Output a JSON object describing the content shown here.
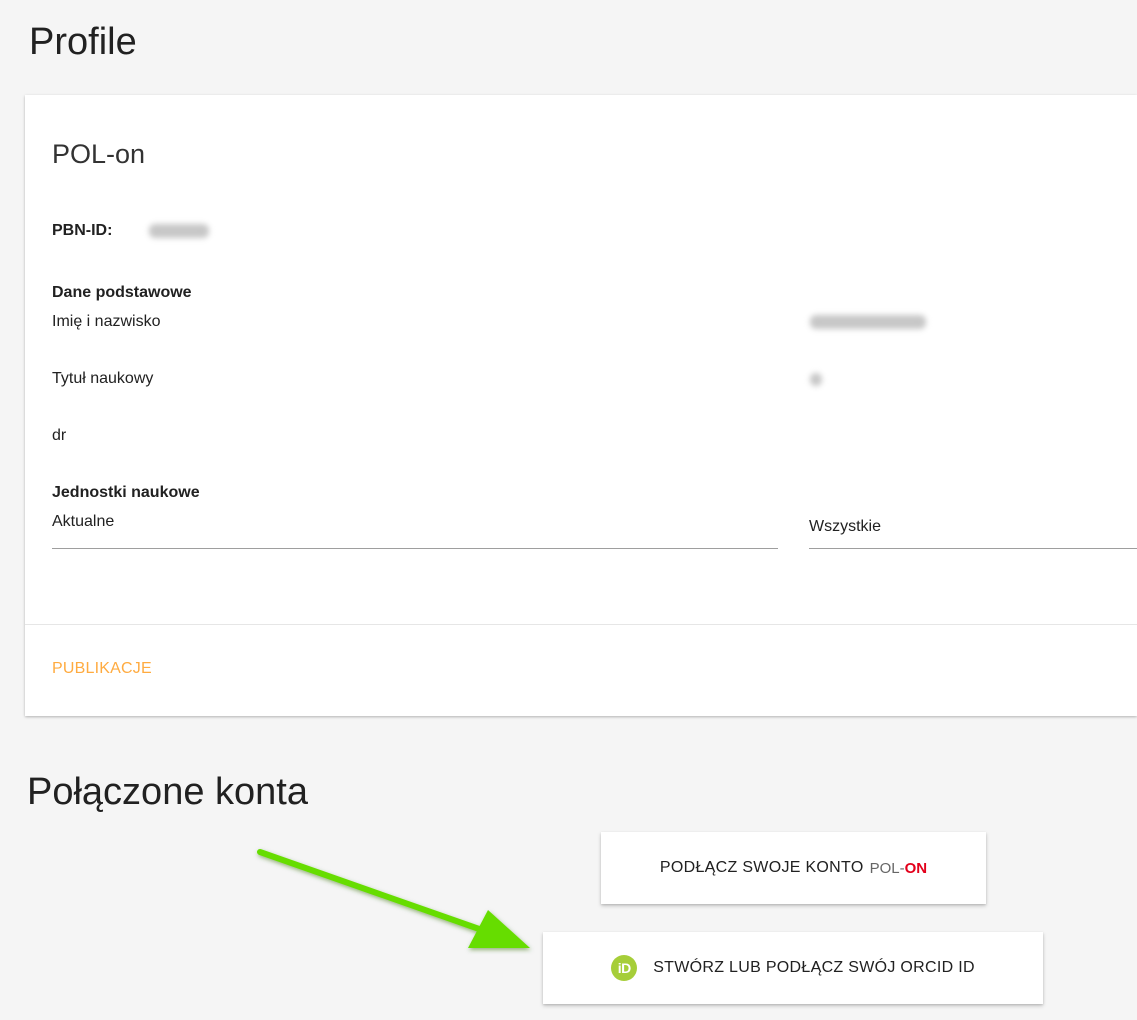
{
  "page": {
    "title": "Profile"
  },
  "polon_card": {
    "title": "POL-on",
    "pbn_label": "PBN-ID:",
    "basic_data_heading": "Dane podstawowe",
    "name_label": "Imię i nazwisko",
    "title_label": "Tytuł naukowy",
    "title_value": "dr",
    "units_heading": "Jednostki naukowe",
    "current_select": "Aktualne",
    "all_select": "Wszystkie",
    "action_label": "PUBLIKACJE"
  },
  "linked_accounts": {
    "title": "Połączone konta",
    "polon_button_label": "PODŁĄCZ SWOJE KONTO",
    "polon_logo_left": "POL-",
    "polon_logo_right": "ON",
    "orcid_icon_text": "iD",
    "orcid_button_label": "STWÓRZ LUB PODŁĄCZ SWÓJ ORCID ID"
  },
  "colors": {
    "background": "#f5f5f5",
    "accent_action": "#ffab40",
    "orcid_green": "#a6ce39",
    "polon_red": "#e3001b",
    "arrow_green": "#66dd00"
  },
  "icons": {
    "orcid": "orcid-icon",
    "annotation_arrow": "arrow-icon"
  }
}
